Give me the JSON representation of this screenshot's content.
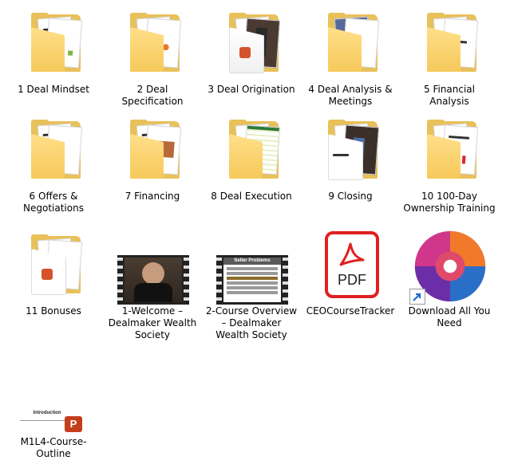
{
  "items": {
    "i1": {
      "label": "1 Deal Mindset",
      "icon": "folder-icon"
    },
    "i2": {
      "label": "2 Deal Specification",
      "icon": "folder-icon"
    },
    "i3": {
      "label": "3 Deal Origination",
      "icon": "folder-icon"
    },
    "i4": {
      "label": "4 Deal Analysis & Meetings",
      "icon": "folder-icon"
    },
    "i5": {
      "label": "5 Financial Analysis",
      "icon": "folder-icon"
    },
    "i6": {
      "label": "6 Offers & Negotiations",
      "icon": "folder-icon"
    },
    "i7": {
      "label": "7 Financing",
      "icon": "folder-icon"
    },
    "i8": {
      "label": "8 Deal Execution",
      "icon": "folder-icon"
    },
    "i9": {
      "label": "9 Closing",
      "icon": "folder-icon"
    },
    "i10": {
      "label": "10 100-Day Ownership Training",
      "icon": "folder-icon"
    },
    "i11": {
      "label": "11 Bonuses",
      "icon": "folder-icon"
    },
    "i12": {
      "label": "1-Welcome – Dealmaker Wealth Society",
      "icon": "video-file-icon"
    },
    "i13": {
      "label": "2-Course Overview – Dealmaker Wealth Society",
      "icon": "video-file-icon"
    },
    "i14": {
      "label": "CEOCourseTracker",
      "icon": "pdf-file-icon"
    },
    "i15": {
      "label": "Download All You Need",
      "icon": "app-shortcut-icon"
    },
    "i16": {
      "label": "M1L4-Course-Outline",
      "icon": "powerpoint-file-icon"
    }
  },
  "thumb_text": {
    "pdf": "PDF",
    "seller_problems": "Seller Problems",
    "introduction": "Introduction",
    "ppt_badge": "P"
  },
  "colors": {
    "folder": "#f6c95a",
    "pdf_red": "#e02020",
    "ppt": "#c43e1c"
  }
}
